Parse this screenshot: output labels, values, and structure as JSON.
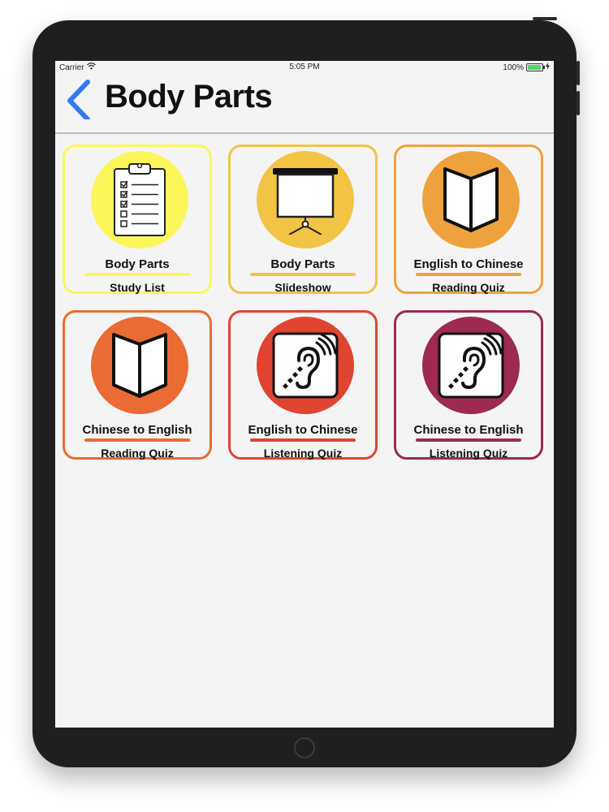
{
  "status_bar": {
    "carrier": "Carrier",
    "time": "5:05 PM",
    "battery": "100%"
  },
  "nav": {
    "title": "Body Parts",
    "back_icon": "chevron-left-icon",
    "accent_color": "#3478f6"
  },
  "tiles": [
    {
      "title": "Body Parts",
      "subtitle": "Study List",
      "icon": "clipboard-checklist-icon",
      "color": "#fbf65a",
      "circle_color": "#fbf65a"
    },
    {
      "title": "Body Parts",
      "subtitle": "Slideshow",
      "icon": "projector-screen-icon",
      "color": "#f2c443",
      "circle_color": "#f2c443"
    },
    {
      "title": "English to Chinese",
      "subtitle": "Reading Quiz",
      "icon": "open-book-icon",
      "color": "#eea23d",
      "circle_color": "#eea23d"
    },
    {
      "title": "Chinese to English",
      "subtitle": "Reading Quiz",
      "icon": "open-book-icon",
      "color": "#ea6b33",
      "circle_color": "#ea6b33"
    },
    {
      "title": "English to Chinese",
      "subtitle": "Listening Quiz",
      "icon": "hearing-ear-icon",
      "color": "#e04431",
      "circle_color": "#e04431"
    },
    {
      "title": "Chinese to English",
      "subtitle": "Listening Quiz",
      "icon": "hearing-ear-icon",
      "color": "#9c2a52",
      "circle_color": "#9c2a52"
    }
  ]
}
